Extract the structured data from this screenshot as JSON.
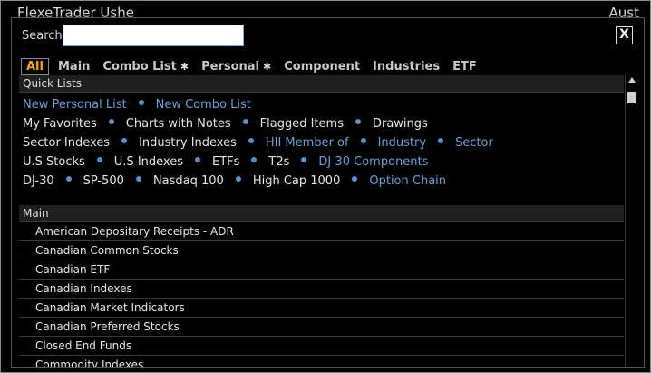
{
  "background": {
    "title": "FlexeTrader Ushe",
    "right_text": "Aust"
  },
  "search": {
    "label": "Search",
    "value": "",
    "placeholder": ""
  },
  "close_label": "X",
  "tabs": [
    {
      "label": "All",
      "active": true,
      "star": false
    },
    {
      "label": "Main",
      "active": false,
      "star": false
    },
    {
      "label": "Combo List",
      "active": false,
      "star": true
    },
    {
      "label": "Personal",
      "active": false,
      "star": true
    },
    {
      "label": "Component",
      "active": false,
      "star": false
    },
    {
      "label": "Industries",
      "active": false,
      "star": false
    },
    {
      "label": "ETF",
      "active": false,
      "star": false
    }
  ],
  "star_glyph": "✱",
  "quick_lists": {
    "header": "Quick Lists",
    "rows": [
      [
        {
          "label": "New Personal List",
          "link": true
        },
        {
          "label": "New Combo List",
          "link": true
        }
      ],
      [
        {
          "label": "My Favorites",
          "link": false
        },
        {
          "label": "Charts with Notes",
          "link": false
        },
        {
          "label": "Flagged Items",
          "link": false
        },
        {
          "label": "Drawings",
          "link": false
        }
      ],
      [
        {
          "label": "Sector Indexes",
          "link": false
        },
        {
          "label": "Industry Indexes",
          "link": false
        },
        {
          "label": "HII Member of",
          "link": true
        },
        {
          "label": "Industry",
          "link": true
        },
        {
          "label": "Sector",
          "link": true
        }
      ],
      [
        {
          "label": "U.S Stocks",
          "link": false
        },
        {
          "label": "U.S Indexes",
          "link": false
        },
        {
          "label": "ETFs",
          "link": false
        },
        {
          "label": "T2s",
          "link": false
        },
        {
          "label": "DJ-30 Components",
          "link": true
        }
      ],
      [
        {
          "label": "DJ-30",
          "link": false
        },
        {
          "label": "SP-500",
          "link": false
        },
        {
          "label": "Nasdaq 100",
          "link": false
        },
        {
          "label": "High Cap 1000",
          "link": false
        },
        {
          "label": "Option Chain",
          "link": true
        }
      ]
    ]
  },
  "main": {
    "header": "Main",
    "items": [
      "American Depositary Receipts - ADR",
      "Canadian Common Stocks",
      "Canadian ETF",
      "Canadian Indexes",
      "Canadian Market Indicators",
      "Canadian Preferred Stocks",
      "Closed End Funds",
      "Commodity Indexes"
    ]
  },
  "colors": {
    "active_tab": "#f5a800",
    "link": "#6d9ed6",
    "bullet": "#5f8fc8",
    "background": "#000000"
  }
}
